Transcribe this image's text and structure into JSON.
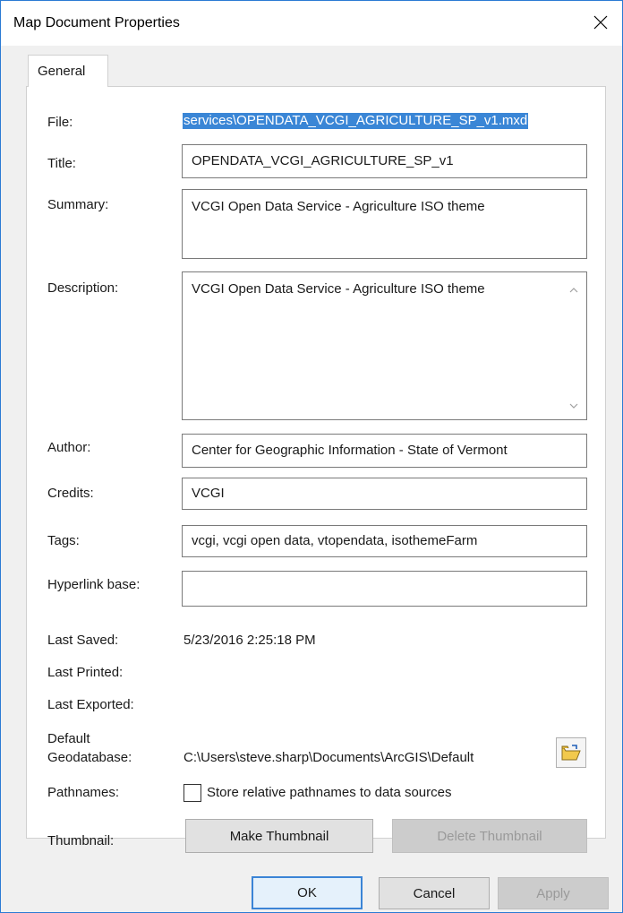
{
  "window": {
    "title": "Map Document Properties"
  },
  "tabs": [
    {
      "label": "General"
    }
  ],
  "labels": {
    "file": "File:",
    "title": "Title:",
    "summary": "Summary:",
    "description": "Description:",
    "author": "Author:",
    "credits": "Credits:",
    "tags": "Tags:",
    "hyperlink_base": "Hyperlink base:",
    "last_saved": "Last Saved:",
    "last_printed": "Last Printed:",
    "last_exported": "Last Exported:",
    "default_gdb_line1": "Default",
    "default_gdb_line2": "Geodatabase:",
    "pathnames": "Pathnames:",
    "thumbnail": "Thumbnail:"
  },
  "fields": {
    "file": "services\\OPENDATA_VCGI_AGRICULTURE_SP_v1.mxd",
    "title": "OPENDATA_VCGI_AGRICULTURE_SP_v1",
    "summary": "VCGI Open Data Service - Agriculture ISO theme",
    "description": "VCGI Open Data Service - Agriculture ISO theme",
    "author": "Center for Geographic Information - State of Vermont",
    "credits": "VCGI",
    "tags": "vcgi, vcgi open data, vtopendata, isothemeFarm",
    "hyperlink_base": ""
  },
  "info": {
    "last_saved": "5/23/2016 2:25:18 PM",
    "last_printed": "",
    "last_exported": "",
    "default_gdb": "C:\\Users\\steve.sharp\\Documents\\ArcGIS\\Default"
  },
  "pathnames": {
    "checkbox_label": "Store relative pathnames to data sources",
    "checked": false
  },
  "buttons": {
    "make_thumbnail": "Make Thumbnail",
    "delete_thumbnail": "Delete Thumbnail",
    "ok": "OK",
    "cancel": "Cancel",
    "apply": "Apply"
  }
}
